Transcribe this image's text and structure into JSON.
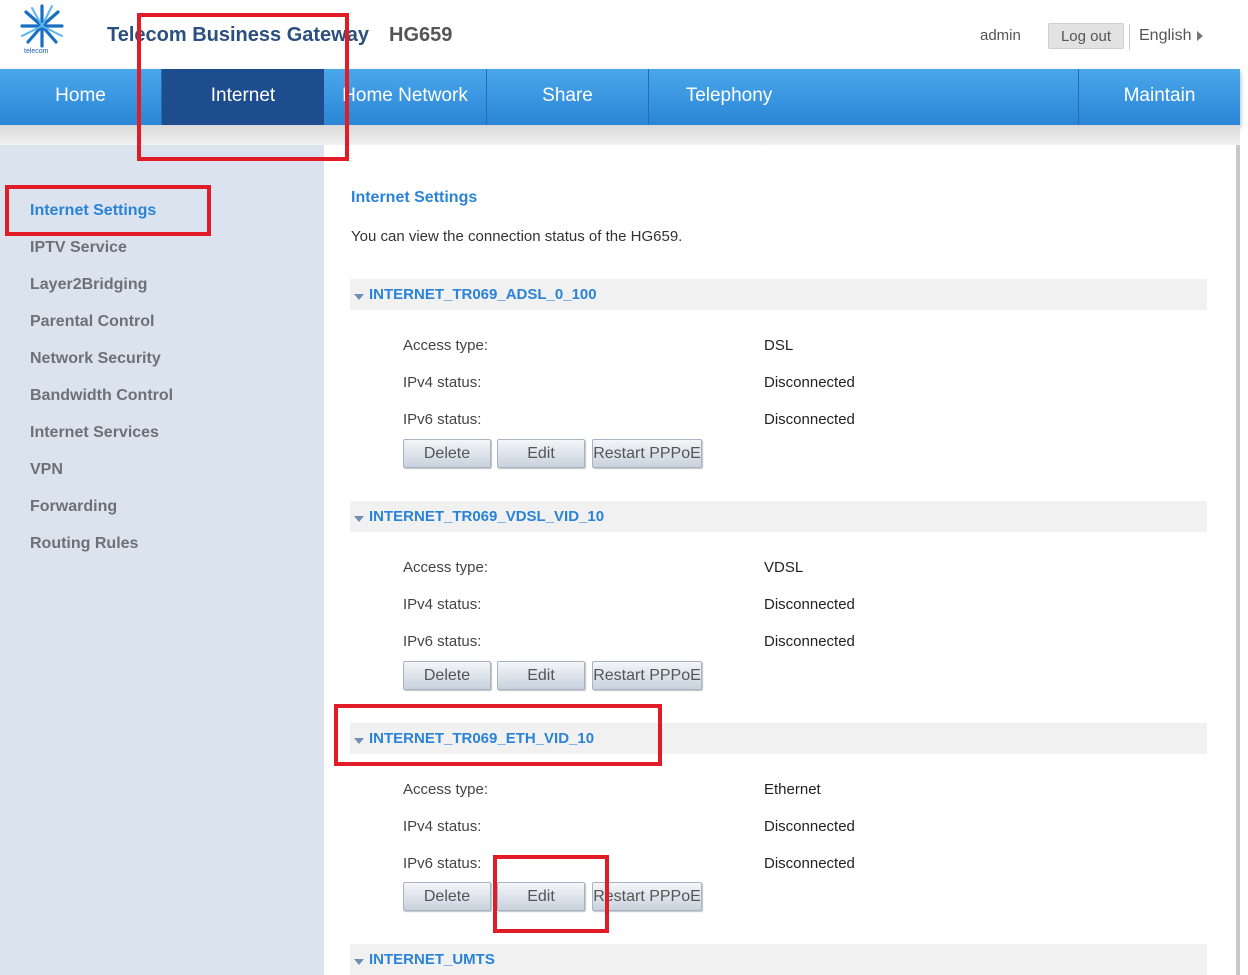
{
  "header": {
    "logo_text": "telecom",
    "app_title": "Telecom Business Gateway",
    "model": "HG659",
    "user": "admin",
    "logout_label": "Log out",
    "language": "English"
  },
  "nav": {
    "items": [
      {
        "label": "Home"
      },
      {
        "label": "Internet",
        "active": true
      },
      {
        "label": "Home Network"
      },
      {
        "label": "Share"
      },
      {
        "label": "Telephony"
      },
      {
        "label": "Maintain"
      }
    ]
  },
  "sidebar": {
    "items": [
      {
        "label": "Internet Settings",
        "active": true
      },
      {
        "label": "IPTV Service"
      },
      {
        "label": "Layer2Bridging"
      },
      {
        "label": "Parental Control"
      },
      {
        "label": "Network Security"
      },
      {
        "label": "Bandwidth Control"
      },
      {
        "label": "Internet Services"
      },
      {
        "label": "VPN"
      },
      {
        "label": "Forwarding"
      },
      {
        "label": "Routing Rules"
      }
    ]
  },
  "main": {
    "title": "Internet Settings",
    "description": "You can view the connection status of the HG659.",
    "field_labels": {
      "access_type": "Access type:",
      "ipv4_status": "IPv4 status:",
      "ipv6_status": "IPv6 status:"
    },
    "buttons": {
      "delete": "Delete",
      "edit": "Edit",
      "restart": "Restart PPPoE"
    },
    "connections": [
      {
        "name": "INTERNET_TR069_ADSL_0_100",
        "access_type": "DSL",
        "ipv4_status": "Disconnected",
        "ipv6_status": "Disconnected"
      },
      {
        "name": "INTERNET_TR069_VDSL_VID_10",
        "access_type": "VDSL",
        "ipv4_status": "Disconnected",
        "ipv6_status": "Disconnected"
      },
      {
        "name": "INTERNET_TR069_ETH_VID_10",
        "access_type": "Ethernet",
        "ipv4_status": "Disconnected",
        "ipv6_status": "Disconnected"
      },
      {
        "name": "INTERNET_UMTS"
      }
    ]
  },
  "colors": {
    "nav_blue": "#3a98e2",
    "nav_active": "#1d4d8f",
    "link_blue": "#2a83d6",
    "sidebar_bg": "#dbe4ee",
    "highlight_red": "#e21c26"
  }
}
